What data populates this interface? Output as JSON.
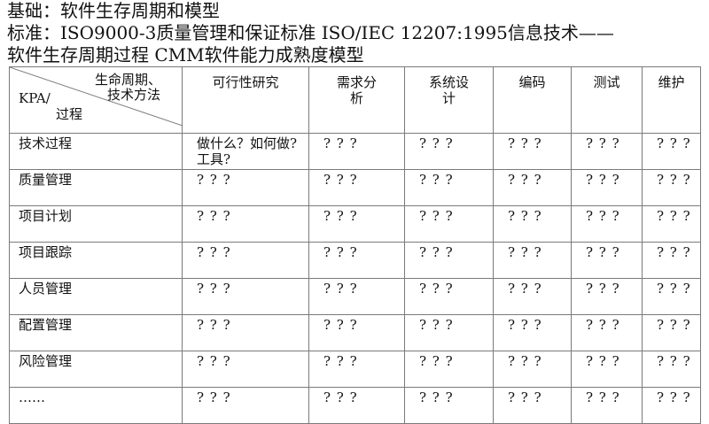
{
  "header": {
    "line1": "基础：软件生存周期和模型",
    "line2": "标准：ISO9000-3质量管理和保证标准 ISO/IEC 12207:1995信息技术——",
    "line3": "软件生存周期过程  CMM软件能力成熟度模型"
  },
  "table": {
    "corner": {
      "top_right_1": "生命周期、",
      "top_right_2": "技术方法",
      "bottom_left_1": "KPA/",
      "bottom_left_2": "过程"
    },
    "columns": [
      "可行性研究",
      "需求分析",
      "系统设计",
      "编码",
      "测试",
      "维护"
    ],
    "rows": [
      {
        "label": "技术过程",
        "cells": [
          "做什么？如何做?工具?",
          "? ? ?",
          "? ? ?",
          "? ? ?",
          "? ? ?",
          "? ? ?"
        ]
      },
      {
        "label": "质量管理",
        "cells": [
          "? ? ?",
          "? ? ?",
          "? ? ?",
          "? ? ?",
          "? ? ?",
          "? ? ?"
        ]
      },
      {
        "label": "项目计划",
        "cells": [
          "? ? ?",
          "? ? ?",
          "? ? ?",
          "? ? ?",
          "? ? ?",
          "? ? ?"
        ]
      },
      {
        "label": "项目跟踪",
        "cells": [
          "? ? ?",
          "? ? ?",
          "? ? ?",
          "? ? ?",
          "? ? ?",
          "? ? ?"
        ]
      },
      {
        "label": "人员管理",
        "cells": [
          "? ? ?",
          "? ? ?",
          "? ? ?",
          "? ? ?",
          "? ? ?",
          "? ? ?"
        ]
      },
      {
        "label": "配置管理",
        "cells": [
          "? ? ?",
          "? ? ?",
          "? ? ?",
          "? ? ?",
          "? ? ?",
          "? ? ?"
        ]
      },
      {
        "label": "风险管理",
        "cells": [
          "? ? ?",
          "? ? ?",
          "? ? ?",
          "? ? ?",
          "? ? ?",
          "? ? ?"
        ]
      },
      {
        "label": "……",
        "cells": [
          "? ? ?",
          "? ? ?",
          "? ? ?",
          "? ? ?",
          "? ? ?",
          "? ? ?"
        ]
      }
    ]
  }
}
